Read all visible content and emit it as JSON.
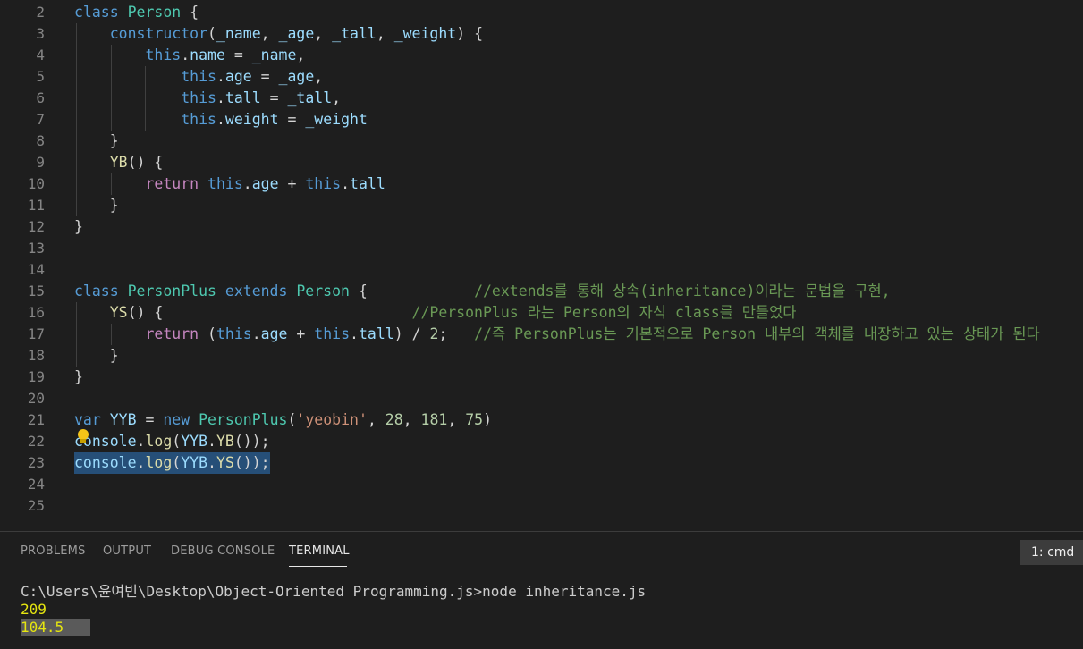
{
  "editor": {
    "lines": [
      {
        "n": "2",
        "tokens": [
          {
            "t": "class ",
            "c": "kw"
          },
          {
            "t": "Person",
            "c": "cls"
          },
          {
            "t": " {",
            "c": ""
          }
        ]
      },
      {
        "n": "3",
        "tokens": [
          {
            "t": "    ",
            "c": ""
          },
          {
            "t": "constructor",
            "c": "kw"
          },
          {
            "t": "(",
            "c": ""
          },
          {
            "t": "_name",
            "c": "var"
          },
          {
            "t": ", ",
            "c": ""
          },
          {
            "t": "_age",
            "c": "var"
          },
          {
            "t": ", ",
            "c": ""
          },
          {
            "t": "_tall",
            "c": "var"
          },
          {
            "t": ", ",
            "c": ""
          },
          {
            "t": "_weight",
            "c": "var"
          },
          {
            "t": ") {",
            "c": ""
          }
        ]
      },
      {
        "n": "4",
        "tokens": [
          {
            "t": "        ",
            "c": ""
          },
          {
            "t": "this",
            "c": "kw"
          },
          {
            "t": ".",
            "c": ""
          },
          {
            "t": "name",
            "c": "var"
          },
          {
            "t": " = ",
            "c": ""
          },
          {
            "t": "_name",
            "c": "var"
          },
          {
            "t": ",",
            "c": ""
          }
        ]
      },
      {
        "n": "5",
        "tokens": [
          {
            "t": "            ",
            "c": ""
          },
          {
            "t": "this",
            "c": "kw"
          },
          {
            "t": ".",
            "c": ""
          },
          {
            "t": "age",
            "c": "var"
          },
          {
            "t": " = ",
            "c": ""
          },
          {
            "t": "_age",
            "c": "var"
          },
          {
            "t": ",",
            "c": ""
          }
        ]
      },
      {
        "n": "6",
        "tokens": [
          {
            "t": "            ",
            "c": ""
          },
          {
            "t": "this",
            "c": "kw"
          },
          {
            "t": ".",
            "c": ""
          },
          {
            "t": "tall",
            "c": "var"
          },
          {
            "t": " = ",
            "c": ""
          },
          {
            "t": "_tall",
            "c": "var"
          },
          {
            "t": ",",
            "c": ""
          }
        ]
      },
      {
        "n": "7",
        "tokens": [
          {
            "t": "            ",
            "c": ""
          },
          {
            "t": "this",
            "c": "kw"
          },
          {
            "t": ".",
            "c": ""
          },
          {
            "t": "weight",
            "c": "var"
          },
          {
            "t": " = ",
            "c": ""
          },
          {
            "t": "_weight",
            "c": "var"
          }
        ]
      },
      {
        "n": "8",
        "tokens": [
          {
            "t": "    }",
            "c": ""
          }
        ]
      },
      {
        "n": "9",
        "tokens": [
          {
            "t": "    ",
            "c": ""
          },
          {
            "t": "YB",
            "c": "fn"
          },
          {
            "t": "() {",
            "c": ""
          }
        ]
      },
      {
        "n": "10",
        "tokens": [
          {
            "t": "        ",
            "c": ""
          },
          {
            "t": "return",
            "c": "ctl"
          },
          {
            "t": " ",
            "c": ""
          },
          {
            "t": "this",
            "c": "kw"
          },
          {
            "t": ".",
            "c": ""
          },
          {
            "t": "age",
            "c": "var"
          },
          {
            "t": " + ",
            "c": ""
          },
          {
            "t": "this",
            "c": "kw"
          },
          {
            "t": ".",
            "c": ""
          },
          {
            "t": "tall",
            "c": "var"
          }
        ]
      },
      {
        "n": "11",
        "tokens": [
          {
            "t": "    }",
            "c": ""
          }
        ]
      },
      {
        "n": "12",
        "tokens": [
          {
            "t": "}",
            "c": ""
          }
        ]
      },
      {
        "n": "13",
        "tokens": []
      },
      {
        "n": "14",
        "tokens": []
      },
      {
        "n": "15",
        "tokens": [
          {
            "t": "class ",
            "c": "kw"
          },
          {
            "t": "PersonPlus",
            "c": "cls"
          },
          {
            "t": " ",
            "c": ""
          },
          {
            "t": "extends",
            "c": "kw"
          },
          {
            "t": " ",
            "c": ""
          },
          {
            "t": "Person",
            "c": "cls"
          },
          {
            "t": " {            ",
            "c": ""
          },
          {
            "t": "//extends를 통해 상속(inheritance)이라는 문법을 구현,",
            "c": "cmt"
          }
        ]
      },
      {
        "n": "16",
        "tokens": [
          {
            "t": "    ",
            "c": ""
          },
          {
            "t": "YS",
            "c": "fn"
          },
          {
            "t": "() {                            ",
            "c": ""
          },
          {
            "t": "//PersonPlus 라는 Person의 자식 class를 만들었다",
            "c": "cmt"
          }
        ]
      },
      {
        "n": "17",
        "tokens": [
          {
            "t": "        ",
            "c": ""
          },
          {
            "t": "return",
            "c": "ctl"
          },
          {
            "t": " (",
            "c": ""
          },
          {
            "t": "this",
            "c": "kw"
          },
          {
            "t": ".",
            "c": ""
          },
          {
            "t": "age",
            "c": "var"
          },
          {
            "t": " + ",
            "c": ""
          },
          {
            "t": "this",
            "c": "kw"
          },
          {
            "t": ".",
            "c": ""
          },
          {
            "t": "tall",
            "c": "var"
          },
          {
            "t": ") / ",
            "c": ""
          },
          {
            "t": "2",
            "c": "num"
          },
          {
            "t": ";   ",
            "c": ""
          },
          {
            "t": "//즉 PersonPlus는 기본적으로 Person 내부의 객체를 내장하고 있는 상태가 된다",
            "c": "cmt"
          }
        ]
      },
      {
        "n": "18",
        "tokens": [
          {
            "t": "    }",
            "c": ""
          }
        ]
      },
      {
        "n": "19",
        "tokens": [
          {
            "t": "}",
            "c": ""
          }
        ]
      },
      {
        "n": "20",
        "tokens": []
      },
      {
        "n": "21",
        "tokens": [
          {
            "t": "var",
            "c": "kw"
          },
          {
            "t": " ",
            "c": ""
          },
          {
            "t": "YYB",
            "c": "var"
          },
          {
            "t": " = ",
            "c": ""
          },
          {
            "t": "new",
            "c": "kw"
          },
          {
            "t": " ",
            "c": ""
          },
          {
            "t": "PersonPlus",
            "c": "cls"
          },
          {
            "t": "(",
            "c": ""
          },
          {
            "t": "'yeobin'",
            "c": "str"
          },
          {
            "t": ", ",
            "c": ""
          },
          {
            "t": "28",
            "c": "num"
          },
          {
            "t": ", ",
            "c": ""
          },
          {
            "t": "181",
            "c": "num"
          },
          {
            "t": ", ",
            "c": ""
          },
          {
            "t": "75",
            "c": "num"
          },
          {
            "t": ")",
            "c": ""
          }
        ]
      },
      {
        "n": "22",
        "tokens": [
          {
            "t": "console",
            "c": "var"
          },
          {
            "t": ".",
            "c": ""
          },
          {
            "t": "log",
            "c": "fn"
          },
          {
            "t": "(",
            "c": ""
          },
          {
            "t": "YYB",
            "c": "var"
          },
          {
            "t": ".",
            "c": ""
          },
          {
            "t": "YB",
            "c": "fn"
          },
          {
            "t": "());",
            "c": ""
          }
        ]
      },
      {
        "n": "23",
        "selected": true,
        "tokens": [
          {
            "t": "console",
            "c": "var"
          },
          {
            "t": ".",
            "c": ""
          },
          {
            "t": "log",
            "c": "fn"
          },
          {
            "t": "(",
            "c": ""
          },
          {
            "t": "YYB",
            "c": "var"
          },
          {
            "t": ".",
            "c": ""
          },
          {
            "t": "YS",
            "c": "fn"
          },
          {
            "t": "());",
            "c": ""
          }
        ]
      },
      {
        "n": "24",
        "tokens": []
      },
      {
        "n": "25",
        "tokens": []
      }
    ],
    "lightbulb_icon": "lightbulb-icon"
  },
  "panel": {
    "tabs": [
      {
        "label": "PROBLEMS"
      },
      {
        "label": "OUTPUT"
      },
      {
        "label": "DEBUG CONSOLE"
      },
      {
        "label": "TERMINAL",
        "active": true
      }
    ],
    "terminal_select": "1: cmd",
    "terminal_lines": [
      {
        "text": "C:\\Users\\윤여빈\\Desktop\\Object-Oriented Programming.js>node inheritance.js",
        "style": ""
      },
      {
        "text": "209",
        "style": "t-yellow"
      },
      {
        "text": "104.5",
        "style": "t-hl"
      }
    ]
  }
}
